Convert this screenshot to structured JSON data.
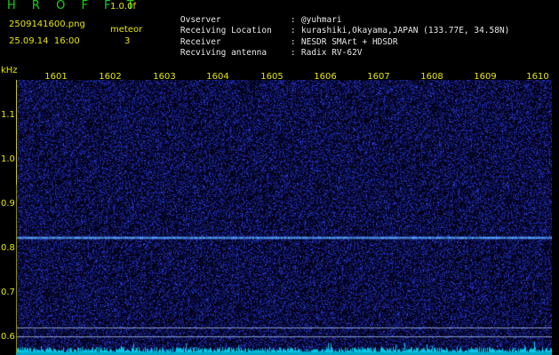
{
  "header": {
    "app_title": "H R O F F T",
    "app_version": "1.0.0f",
    "file_name": "2509141600.png",
    "mode_label": "meteor",
    "date_time": "25.09.14  16:00",
    "count_value": "3"
  },
  "info": [
    {
      "key": "Ovserver",
      "sep": ":",
      "value": "@yuhmari"
    },
    {
      "key": "Receiving Location",
      "sep": ":",
      "value": "kurashiki,Okayama,JAPAN (133.77E, 34.58N)"
    },
    {
      "key": "Receiver",
      "sep": ":",
      "value": "NESDR SMArt + HDSDR"
    },
    {
      "key": "Recviving antenna",
      "sep": ":",
      "value": "Radix RV-62V"
    }
  ],
  "axis": {
    "unit": "kHz",
    "y_ticks": [
      "1.1",
      "1.0",
      "0.9",
      "0.8",
      "0.7",
      "0.6"
    ],
    "time_ticks": [
      "1601",
      "1602",
      "1603",
      "1604",
      "1605",
      "1606",
      "1607",
      "1608",
      "1609",
      "1610"
    ]
  },
  "colors": {
    "background": "#000000",
    "label": "#e6e600",
    "title": "#16d216",
    "noise": "#1a20a0",
    "signal_line": "#4fa8ff",
    "spectrum": "#00c8e6"
  }
}
